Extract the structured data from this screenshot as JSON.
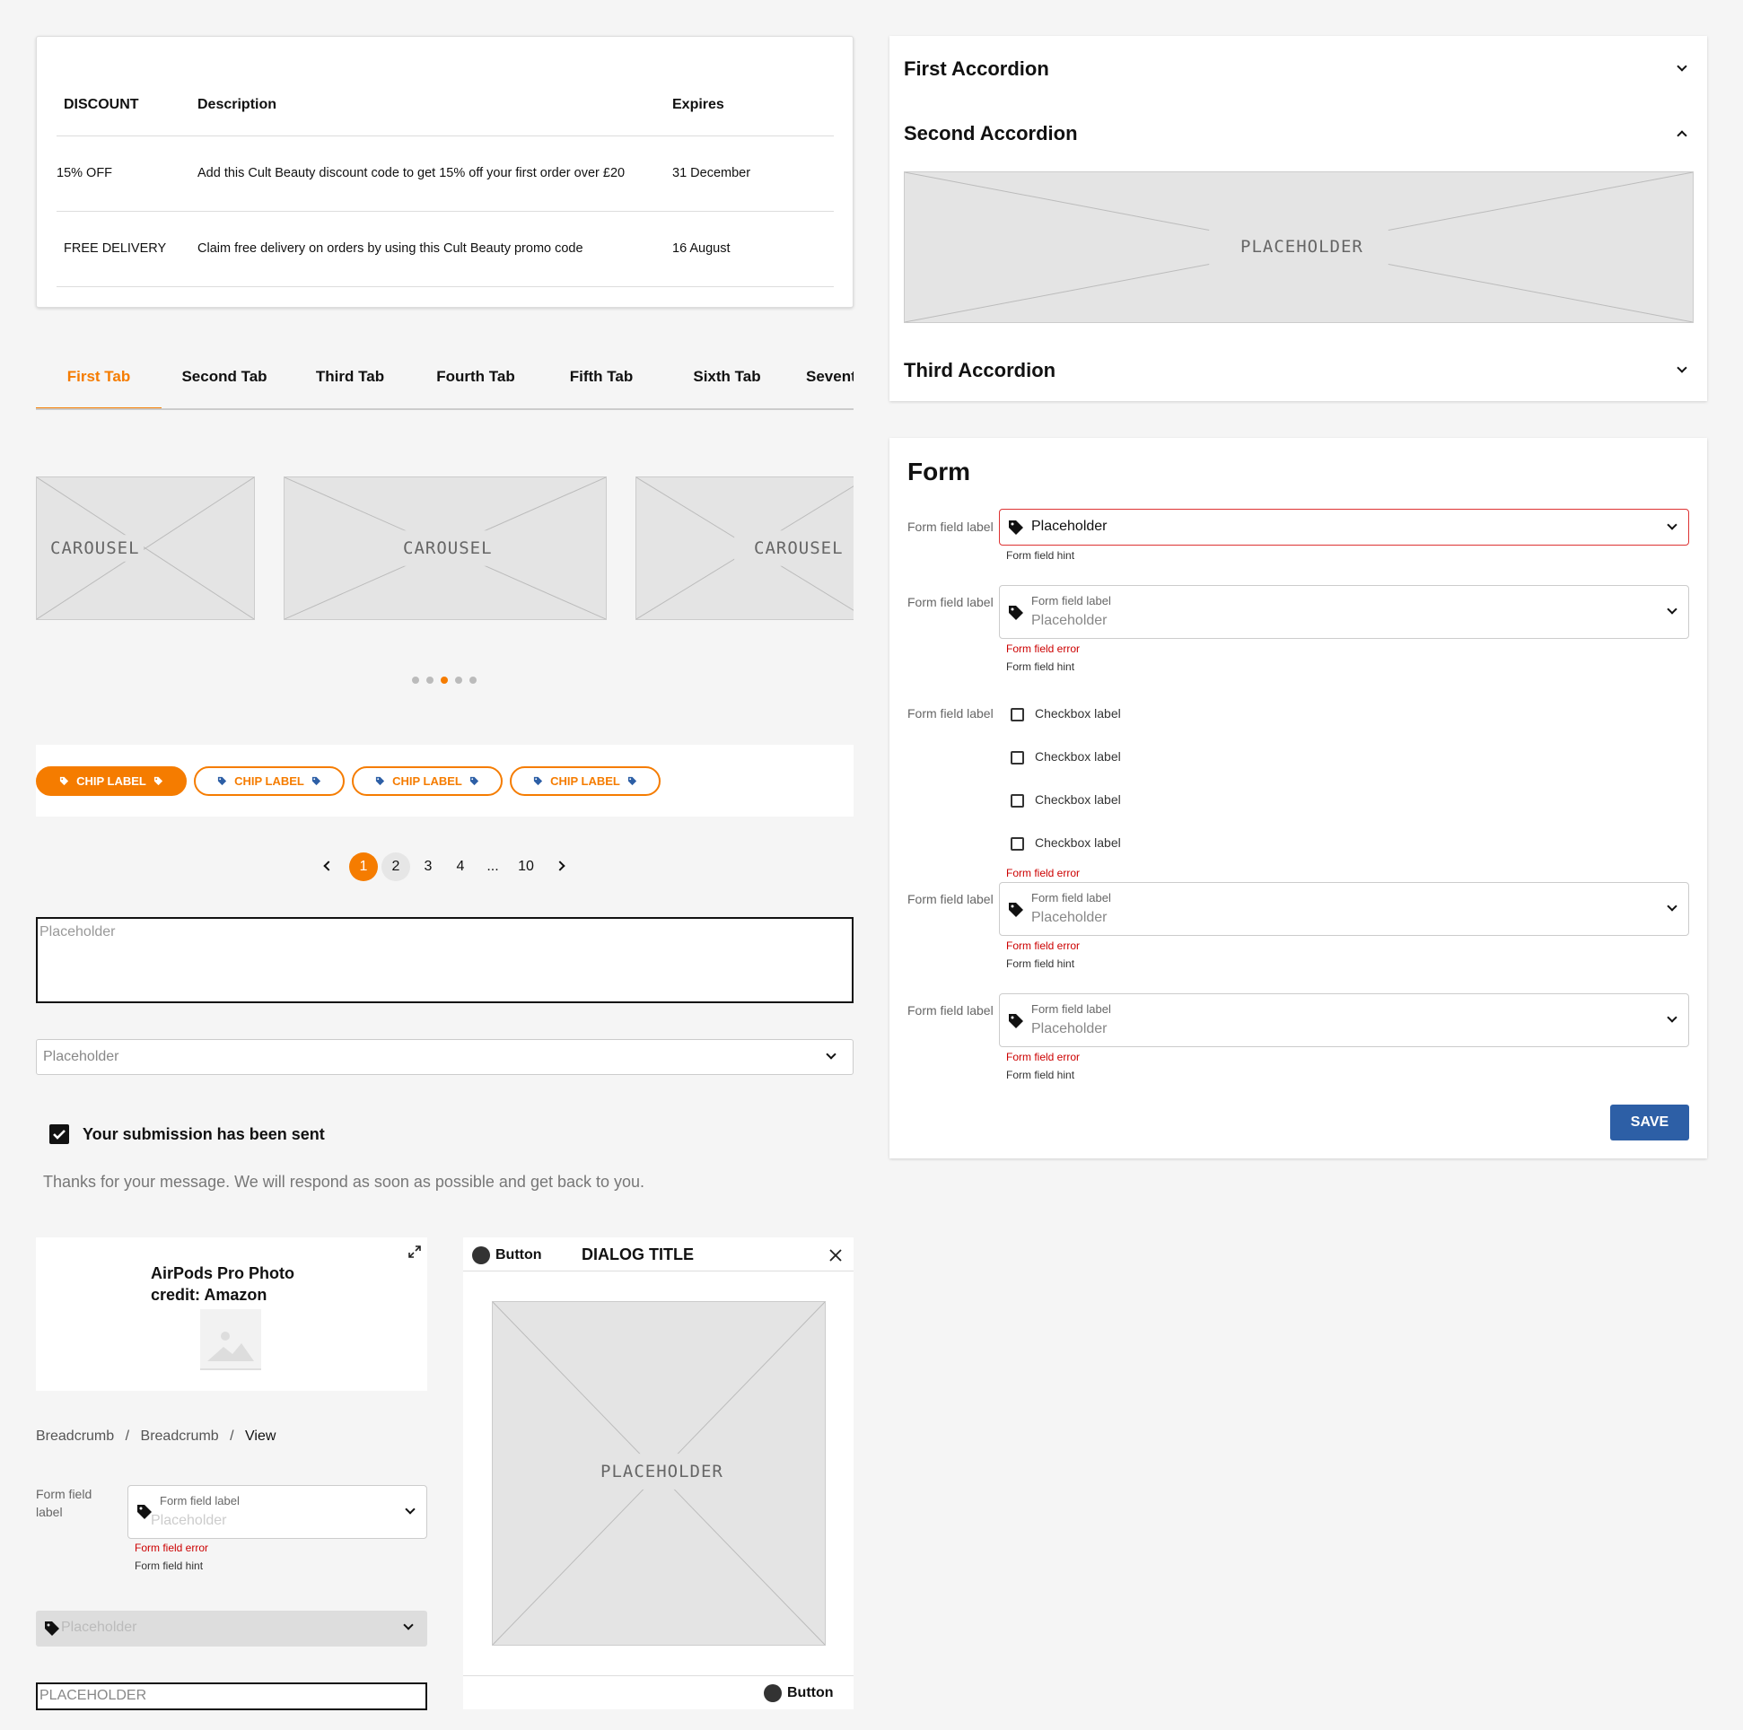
{
  "discount_table": {
    "headers": [
      "DISCOUNT",
      "Description",
      "Expires"
    ],
    "rows": [
      {
        "discount": "15% OFF",
        "description": "Add this Cult Beauty discount code to get 15% off your first order over £20",
        "expires": "31 December"
      },
      {
        "discount": "FREE DELIVERY",
        "description": "Claim free delivery on orders by using this Cult Beauty promo code",
        "expires": "16 August"
      }
    ]
  },
  "tabs": [
    "First Tab",
    "Second Tab",
    "Third Tab",
    "Fourth Tab",
    "Fifth Tab",
    "Sixth Tab",
    "Seventh Tab"
  ],
  "active_tab": 0,
  "carousel": {
    "label": "CAROUSEL",
    "dot_count": 5,
    "active_dot": 2
  },
  "chips": {
    "label": "CHIP LABEL",
    "count": 4,
    "active": 0
  },
  "pagination": [
    "1",
    "2",
    "3",
    "4",
    "...",
    "10"
  ],
  "pagination_active": "1",
  "textarea_placeholder": "Placeholder",
  "select_placeholder": "Placeholder",
  "submission": {
    "title": "Your submission has been sent",
    "text": "Thanks for your message. We will respond as soon as possible and get back to you."
  },
  "image_card": {
    "caption_line1": "AirPods Pro Photo",
    "caption_line2": "credit: Amazon"
  },
  "breadcrumbs": [
    "Breadcrumb",
    "Breadcrumb",
    "View"
  ],
  "breadcrumb_separator": "/",
  "small_form": {
    "label_line1": "Form field",
    "label_line2": "label",
    "field_label": "Form field label",
    "placeholder": "Placeholder",
    "error": "Form field error",
    "hint": "Form field hint"
  },
  "disabled_select_placeholder": "Placeholder",
  "bottom_input_placeholder": "PLACEHOLDER",
  "dialog": {
    "button_label": "Button",
    "title": "DIALOG TITLE",
    "placeholder": "PLACEHOLDER",
    "footer_button": "Button"
  },
  "accordion": {
    "items": [
      "First Accordion",
      "Second Accordion",
      "Third Accordion"
    ],
    "placeholder": "PLACEHOLDER"
  },
  "form": {
    "title": "Form",
    "field_label": "Form field label",
    "placeholder": "Placeholder",
    "hint": "Form field hint",
    "error": "Form field error",
    "checkbox_label": "Checkbox label",
    "save": "SAVE"
  },
  "colors": {
    "accent": "#f57c00",
    "error": "#cc0000",
    "primary": "#2d5fa6"
  }
}
